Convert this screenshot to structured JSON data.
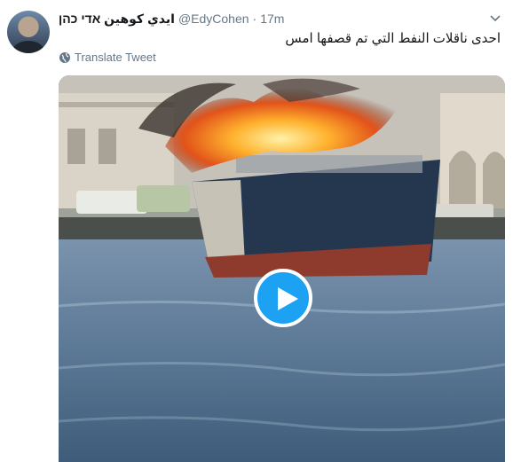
{
  "tweet": {
    "display_name": "ايدي كوهين אדי כהן",
    "handle": "@EdyCohen",
    "separator": "·",
    "time": "17m",
    "text": "احدى ناقلات النفط التي تم قصفها امس",
    "translate_label": "Translate Tweet"
  },
  "icons": {
    "menu": "chevron-down-icon",
    "translate": "globe-icon",
    "play": "play-icon"
  },
  "colors": {
    "accent": "#1da1f2",
    "text": "#14171a",
    "muted": "#657786"
  }
}
